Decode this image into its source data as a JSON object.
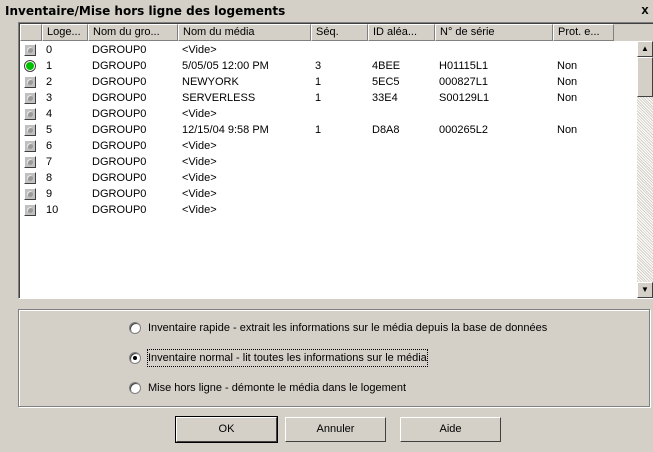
{
  "window": {
    "title": "Inventaire/Mise hors ligne des logements",
    "close_label": "x"
  },
  "grid": {
    "columns": [
      "Loge...",
      "Nom du gro...",
      "Nom du média",
      "Séq.",
      "ID aléa...",
      "N° de série",
      "Prot. e..."
    ],
    "rows": [
      {
        "status": "off",
        "slot": "0",
        "group": "DGROUP0",
        "media": "<Vide>",
        "seq": "",
        "id": "",
        "serial": "",
        "prot": ""
      },
      {
        "status": "on",
        "slot": "1",
        "group": "DGROUP0",
        "media": "5/05/05 12:00 PM",
        "seq": "3",
        "id": "4BEE",
        "serial": "H01115L1",
        "prot": "Non"
      },
      {
        "status": "off",
        "slot": "2",
        "group": "DGROUP0",
        "media": "NEWYORK",
        "seq": "1",
        "id": "5EC5",
        "serial": "000827L1",
        "prot": "Non"
      },
      {
        "status": "off",
        "slot": "3",
        "group": "DGROUP0",
        "media": "SERVERLESS",
        "seq": "1",
        "id": "33E4",
        "serial": "S00129L1",
        "prot": "Non"
      },
      {
        "status": "off",
        "slot": "4",
        "group": "DGROUP0",
        "media": "<Vide>",
        "seq": "",
        "id": "",
        "serial": "",
        "prot": ""
      },
      {
        "status": "off",
        "slot": "5",
        "group": "DGROUP0",
        "media": "12/15/04 9:58 PM",
        "seq": "1",
        "id": "D8A8",
        "serial": "000265L2",
        "prot": "Non"
      },
      {
        "status": "off",
        "slot": "6",
        "group": "DGROUP0",
        "media": "<Vide>",
        "seq": "",
        "id": "",
        "serial": "",
        "prot": ""
      },
      {
        "status": "off",
        "slot": "7",
        "group": "DGROUP0",
        "media": "<Vide>",
        "seq": "",
        "id": "",
        "serial": "",
        "prot": ""
      },
      {
        "status": "off",
        "slot": "8",
        "group": "DGROUP0",
        "media": "<Vide>",
        "seq": "",
        "id": "",
        "serial": "",
        "prot": ""
      },
      {
        "status": "off",
        "slot": "9",
        "group": "DGROUP0",
        "media": "<Vide>",
        "seq": "",
        "id": "",
        "serial": "",
        "prot": ""
      },
      {
        "status": "off",
        "slot": "10",
        "group": "DGROUP0",
        "media": "<Vide>",
        "seq": "",
        "id": "",
        "serial": "",
        "prot": ""
      }
    ]
  },
  "options": [
    {
      "label": "Inventaire rapide - extrait les informations sur le média depuis la base de données",
      "checked": false
    },
    {
      "label": "Inventaire normal - lit toutes les informations sur le média",
      "checked": true
    },
    {
      "label": "Mise hors ligne - démonte le média dans le logement",
      "checked": false
    }
  ],
  "buttons": {
    "ok": "OK",
    "cancel": "Annuler",
    "help": "Aide"
  },
  "colors": {
    "led_on": "#00c000",
    "led_off": "#9a9a9a",
    "face": "#d4d0c8"
  }
}
